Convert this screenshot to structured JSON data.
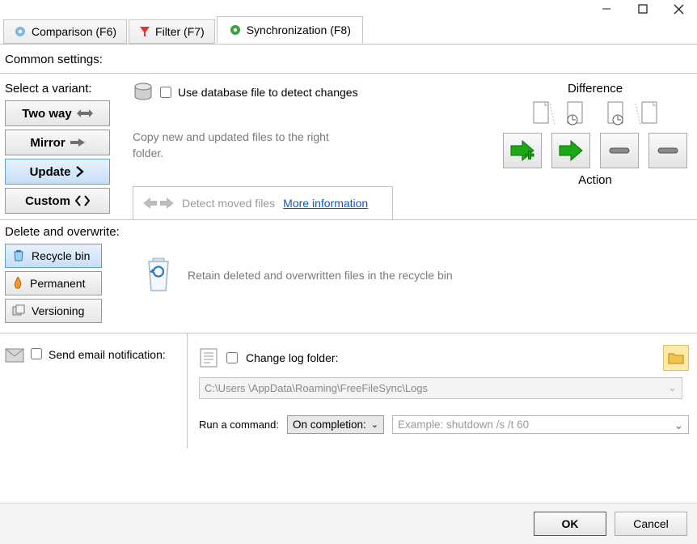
{
  "tabs": {
    "comparison": "Comparison (F6)",
    "filter": "Filter (F7)",
    "synchronization": "Synchronization (F8)"
  },
  "section_common": "Common settings:",
  "variant": {
    "label": "Select a variant:",
    "two_way": "Two way",
    "mirror": "Mirror",
    "update": "Update",
    "custom": "Custom",
    "selected": "Update"
  },
  "use_db_label": "Use database file to detect changes",
  "copy_desc": "Copy new and updated files to the right folder.",
  "detect_moved": "Detect moved files",
  "more_info": "More information",
  "difference_label": "Difference",
  "action_label": "Action",
  "section_delete": "Delete and overwrite:",
  "delete_options": {
    "recycle": "Recycle bin",
    "permanent": "Permanent",
    "versioning": "Versioning",
    "selected": "Recycle bin"
  },
  "delete_desc": "Retain deleted and overwritten files in the recycle bin",
  "email_label": "Send email notification:",
  "change_log_label": "Change log folder:",
  "log_path": "C:\\Users         \\AppData\\Roaming\\FreeFileSync\\Logs",
  "run_label": "Run a command:",
  "run_when": "On completion:",
  "run_cmd_placeholder": "Example: shutdown /s /t 60",
  "buttons": {
    "ok": "OK",
    "cancel": "Cancel"
  }
}
